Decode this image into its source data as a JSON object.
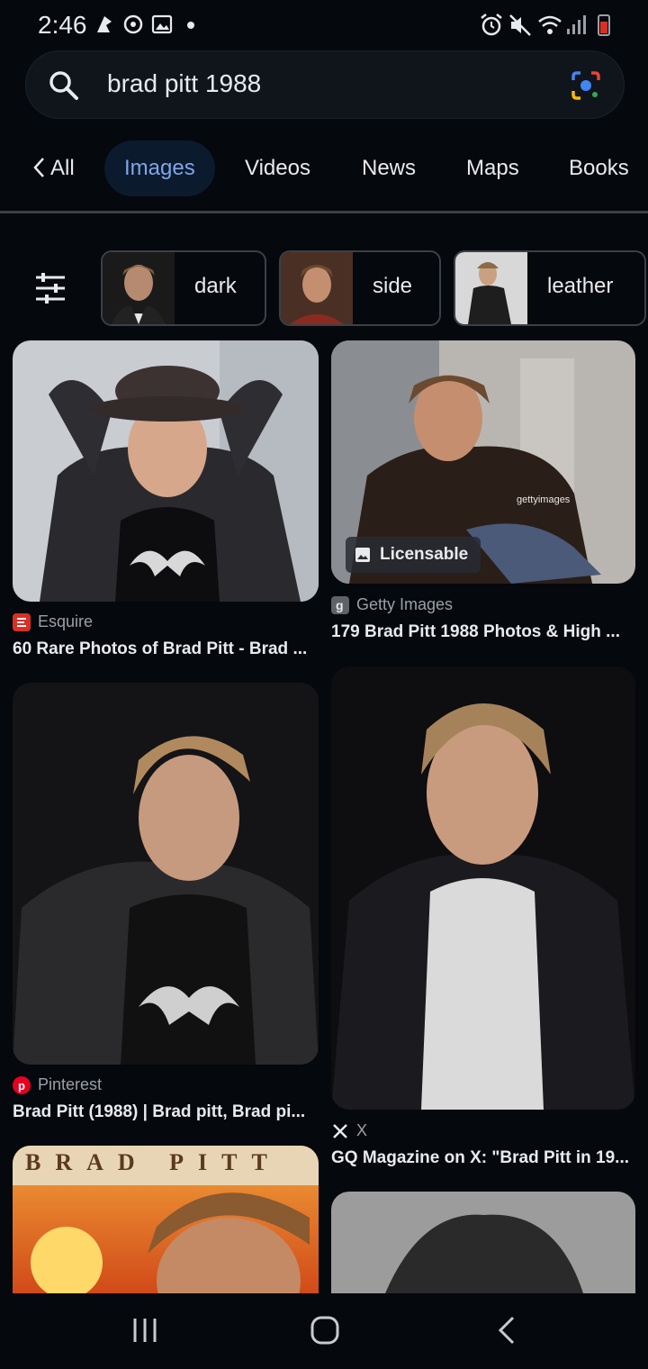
{
  "status": {
    "time": "2:46"
  },
  "search": {
    "query": "brad pitt 1988"
  },
  "tabs": [
    {
      "label": "All"
    },
    {
      "label": "Images"
    },
    {
      "label": "Videos"
    },
    {
      "label": "News"
    },
    {
      "label": "Maps"
    },
    {
      "label": "Books"
    }
  ],
  "chips": [
    {
      "label": "dark"
    },
    {
      "label": "side"
    },
    {
      "label": "leather"
    }
  ],
  "results": [
    {
      "source": "Esquire",
      "title": "60 Rare Photos of Brad Pitt - Brad ..."
    },
    {
      "source": "Getty Images",
      "title": "179 Brad Pitt 1988 Photos & High ...",
      "badge": "Licensable"
    },
    {
      "source": "Pinterest",
      "title": "Brad Pitt (1988) | Brad pitt, Brad pi..."
    },
    {
      "source": "X",
      "title": "GQ Magazine on X: \"Brad Pitt in 19..."
    },
    {
      "source": "",
      "title": "",
      "poster_text": "BRAD PITT"
    }
  ],
  "colors": {
    "accent": "#7ea6e8",
    "background": "#05080d"
  }
}
